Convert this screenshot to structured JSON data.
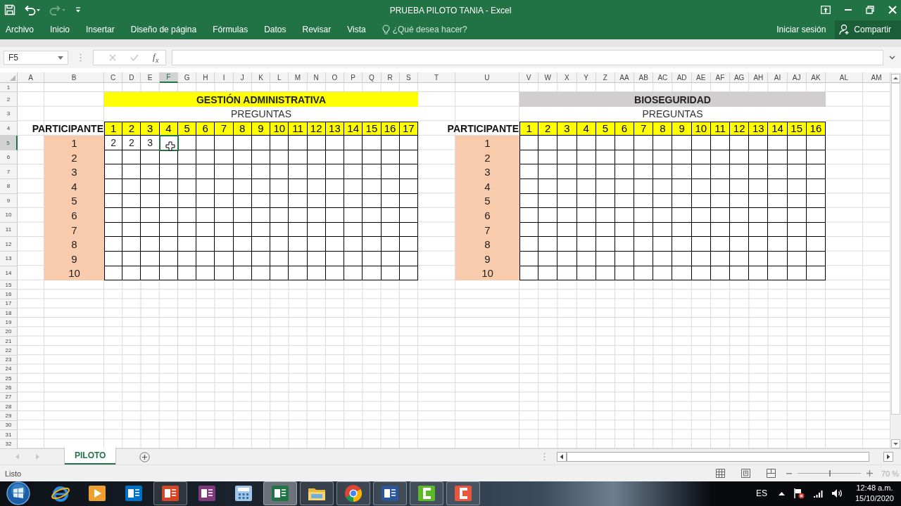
{
  "window": {
    "title": "PRUEBA PILOTO TANIA - Excel"
  },
  "quick_access": [
    {
      "kind": "save",
      "disabled": false
    },
    {
      "kind": "undo",
      "disabled": false
    },
    {
      "kind": "redo",
      "disabled": true
    },
    {
      "kind": "customize",
      "disabled": false
    }
  ],
  "ribbon_tabs": [
    "Archivo",
    "Inicio",
    "Insertar",
    "Diseño de página",
    "Fórmulas",
    "Datos",
    "Revisar",
    "Vista"
  ],
  "tell_me": {
    "placeholder": "¿Qué desea hacer?"
  },
  "sign_in": "Iniciar sesión",
  "share": "Compartir",
  "formula_bar": {
    "name_box": "F5",
    "function_label": "f$_{x}$"
  },
  "sheet": {
    "columns": [
      {
        "label": "A",
        "selected": false
      },
      {
        "label": "B",
        "selected": false
      },
      {
        "label": "C",
        "selected": false
      },
      {
        "label": "D",
        "selected": false
      },
      {
        "label": "E",
        "selected": false
      },
      {
        "label": "F",
        "selected": true
      },
      {
        "label": "G",
        "selected": false
      },
      {
        "label": "H",
        "selected": false
      },
      {
        "label": "I",
        "selected": false
      },
      {
        "label": "J",
        "selected": false
      },
      {
        "label": "K",
        "selected": false
      },
      {
        "label": "L",
        "selected": false
      },
      {
        "label": "M",
        "selected": false
      },
      {
        "label": "N",
        "selected": false
      },
      {
        "label": "O",
        "selected": false
      },
      {
        "label": "P",
        "selected": false
      },
      {
        "label": "Q",
        "selected": false
      },
      {
        "label": "R",
        "selected": false
      },
      {
        "label": "S",
        "selected": false
      },
      {
        "label": "T",
        "selected": false
      },
      {
        "label": "U",
        "selected": false
      },
      {
        "label": "V",
        "selected": false
      },
      {
        "label": "W",
        "selected": false
      },
      {
        "label": "X",
        "selected": false
      },
      {
        "label": "Y",
        "selected": false
      },
      {
        "label": "Z",
        "selected": false
      },
      {
        "label": "AA",
        "selected": false
      },
      {
        "label": "AB",
        "selected": false
      },
      {
        "label": "AC",
        "selected": false
      },
      {
        "label": "AD",
        "selected": false
      },
      {
        "label": "AE",
        "selected": false
      },
      {
        "label": "AF",
        "selected": false
      },
      {
        "label": "AG",
        "selected": false
      },
      {
        "label": "AH",
        "selected": false
      },
      {
        "label": "AI",
        "selected": false
      },
      {
        "label": "AJ",
        "selected": false
      },
      {
        "label": "AK",
        "selected": false
      },
      {
        "label": "AL",
        "selected": false
      },
      {
        "label": "AM",
        "selected": false
      }
    ],
    "rows": [
      {
        "label": "1",
        "selected": false
      },
      {
        "label": "2",
        "selected": false
      },
      {
        "label": "3",
        "selected": false
      },
      {
        "label": "4",
        "selected": false
      },
      {
        "label": "5",
        "selected": true
      },
      {
        "label": "6",
        "selected": false
      },
      {
        "label": "7",
        "selected": false
      },
      {
        "label": "8",
        "selected": false
      },
      {
        "label": "9",
        "selected": false
      },
      {
        "label": "10",
        "selected": false
      },
      {
        "label": "11",
        "selected": false
      },
      {
        "label": "12",
        "selected": false
      },
      {
        "label": "13",
        "selected": false
      },
      {
        "label": "14",
        "selected": false
      },
      {
        "label": "15",
        "selected": false
      },
      {
        "label": "16",
        "selected": false
      },
      {
        "label": "17",
        "selected": false
      },
      {
        "label": "18",
        "selected": false
      },
      {
        "label": "19",
        "selected": false
      },
      {
        "label": "20",
        "selected": false
      },
      {
        "label": "21",
        "selected": false
      },
      {
        "label": "22",
        "selected": false
      },
      {
        "label": "23",
        "selected": false
      },
      {
        "label": "24",
        "selected": false
      },
      {
        "label": "25",
        "selected": false
      },
      {
        "label": "26",
        "selected": false
      },
      {
        "label": "27",
        "selected": false
      },
      {
        "label": "28",
        "selected": false
      },
      {
        "label": "29",
        "selected": false
      },
      {
        "label": "30",
        "selected": false
      },
      {
        "label": "31",
        "selected": false
      },
      {
        "label": "32",
        "selected": false
      }
    ],
    "blocks": [
      {
        "title": "GESTIÓN ADMINISTRATIVA",
        "color": "#ffff00",
        "subtitle": "PREGUNTAS",
        "participant_header": "PARTICIPANTE",
        "questions": [
          "1",
          "2",
          "3",
          "4",
          "5",
          "6",
          "7",
          "8",
          "9",
          "10",
          "11",
          "12",
          "13",
          "14",
          "15",
          "16",
          "17"
        ],
        "participants": [
          {
            "label": "1",
            "answers": [
              "2",
              "2",
              "3"
            ]
          },
          {
            "label": "2"
          },
          {
            "label": "3"
          },
          {
            "label": "4"
          },
          {
            "label": "5"
          },
          {
            "label": "6"
          },
          {
            "label": "7"
          },
          {
            "label": "8"
          },
          {
            "label": "9"
          },
          {
            "label": "10"
          }
        ]
      },
      {
        "title": "BIOSEGURIDAD",
        "color": "#d0cece",
        "subtitle": "PREGUNTAS",
        "participant_header": "PARTICIPANTE",
        "questions": [
          "1",
          "2",
          "3",
          "4",
          "5",
          "6",
          "7",
          "8",
          "9",
          "10",
          "11",
          "12",
          "13",
          "14",
          "15",
          "16"
        ],
        "participants": [
          {
            "label": "1"
          },
          {
            "label": "2"
          },
          {
            "label": "3"
          },
          {
            "label": "4"
          },
          {
            "label": "5"
          },
          {
            "label": "6"
          },
          {
            "label": "7"
          },
          {
            "label": "8"
          },
          {
            "label": "9"
          },
          {
            "label": "10"
          }
        ]
      }
    ]
  },
  "sheet_tabs": [
    {
      "label": "PILOTO",
      "selected": true
    }
  ],
  "status_bar": {
    "status": "Listo",
    "zoom": "70 %"
  },
  "zoom_slider": {
    "level": 0.5
  },
  "taskbar": {
    "apps": [
      {
        "kind": "ie",
        "open": false,
        "selected": false
      },
      {
        "kind": "media",
        "open": false,
        "selected": false
      },
      {
        "kind": "mail",
        "open": false,
        "selected": false
      },
      {
        "kind": "slides",
        "open": true,
        "selected": false
      },
      {
        "kind": "notes",
        "open": false,
        "selected": false
      },
      {
        "kind": "calc",
        "open": false,
        "selected": false
      },
      {
        "kind": "sheet",
        "open": true,
        "selected": true
      },
      {
        "kind": "folder",
        "open": true,
        "selected": false
      },
      {
        "kind": "chrome",
        "open": true,
        "selected": false
      },
      {
        "kind": "word",
        "open": true,
        "selected": false
      },
      {
        "kind": "recorder-green",
        "open": true,
        "selected": false
      },
      {
        "kind": "recorder-red",
        "open": true,
        "selected": false
      }
    ],
    "language": "ES",
    "time": "12:48 a.m.",
    "date": "15/10/2020"
  }
}
